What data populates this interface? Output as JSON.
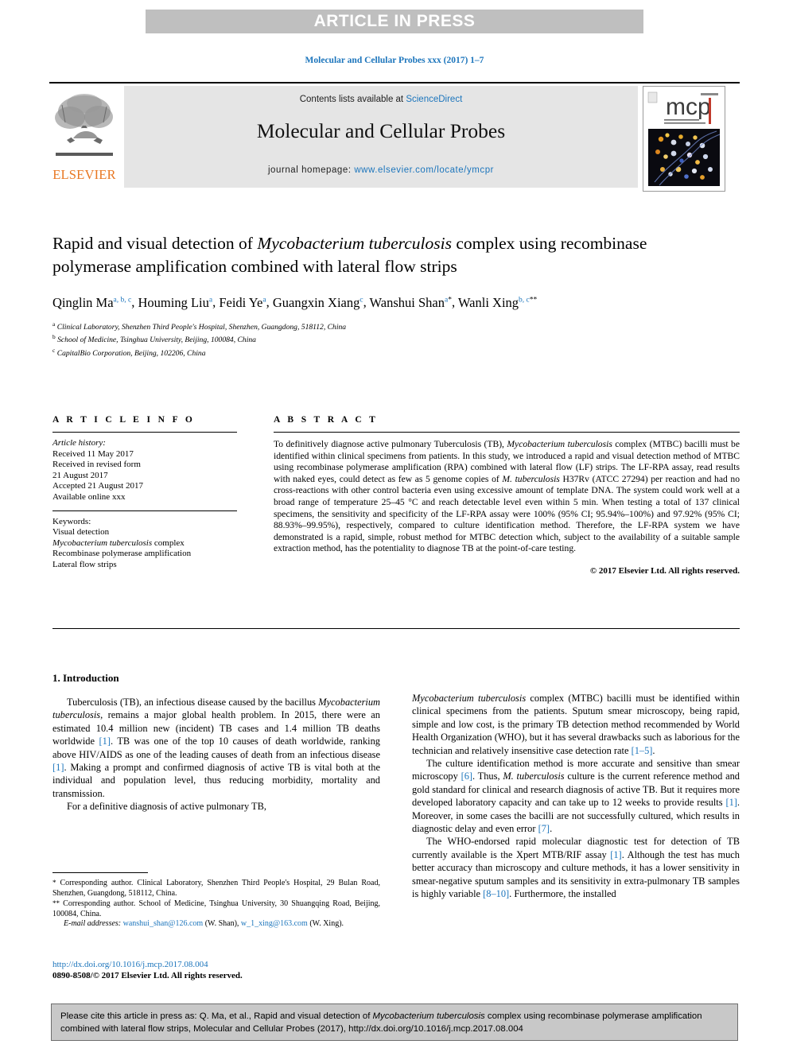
{
  "banner": {
    "label": "ARTICLE IN PRESS"
  },
  "running_head": "Molecular and Cellular Probes xxx (2017) 1–7",
  "masthead": {
    "publisher": "ELSEVIER",
    "contents_prefix": "Contents lists available at ",
    "contents_link": "ScienceDirect",
    "journal_title": "Molecular and Cellular Probes",
    "homepage_prefix": "journal homepage: ",
    "homepage_url": "www.elsevier.com/locate/ymcpr",
    "cover_mark": "mcp",
    "link_color": "#1c75bc",
    "banner_color": "#bfbfbf",
    "band_color": "#e5e5e5",
    "elsevier_orange": "#e87722"
  },
  "title": {
    "line1a": "Rapid and visual detection of ",
    "line1_italic": "Mycobacterium tuberculosis",
    "line1b": " complex",
    "line2": "using recombinase polymerase amplification combined with lateral",
    "line3": "flow strips"
  },
  "authors": [
    {
      "name": "Qinglin Ma",
      "sup": "a, b, c"
    },
    {
      "name": "Houming Liu",
      "sup": "a"
    },
    {
      "name": "Feidi Ye",
      "sup": "a"
    },
    {
      "name": "Guangxin Xiang",
      "sup": "c"
    },
    {
      "name": "Wanshui Shan",
      "sup": "a",
      "star": "*"
    },
    {
      "name": "Wanli Xing",
      "sup": "b, c",
      "star": "**"
    }
  ],
  "affiliations": [
    {
      "mark": "a",
      "text": "Clinical Laboratory, Shenzhen Third People's Hospital, Shenzhen, Guangdong, 518112, China"
    },
    {
      "mark": "b",
      "text": "School of Medicine, Tsinghua University, Beijing, 100084, China"
    },
    {
      "mark": "c",
      "text": "CapitalBio Corporation, Beijing, 102206, China"
    }
  ],
  "article_info": {
    "heading": "A R T I C L E   I N F O",
    "history_label": "Article history:",
    "history": [
      "Received 11 May 2017",
      "Received in revised form",
      "21 August 2017",
      "Accepted 21 August 2017",
      "Available online xxx"
    ],
    "keywords_label": "Keywords:",
    "keywords": [
      "Visual detection",
      "Mycobacterium tuberculosis complex",
      "Recombinase polymerase amplification",
      "Lateral flow strips"
    ]
  },
  "abstract": {
    "heading": "A B S T R A C T",
    "p1": "To definitively diagnose active pulmonary Tuberculosis (TB), ",
    "p1_italic1": "Mycobacterium tuberculosis",
    "p2": " complex (MTBC) bacilli must be identified within clinical specimens from patients. In this study, we introduced a rapid and visual detection method of MTBC using recombinase polymerase amplification (RPA) combined with lateral flow (LF) strips. The LF-RPA assay, read results with naked eyes, could detect as few as 5 genome copies of ",
    "p2_italic": "M. tuberculosis",
    "p3": " H37Rv (ATCC 27294) per reaction and had no cross-reactions with other control bacteria even using excessive amount of template DNA. The system could work well at a broad range of temperature 25–45 °C and reach detectable level even within 5 min. When testing a total of 137 clinical specimens, the sensitivity and specificity of the LF-RPA assay were 100% (95% CI; 95.94%–100%) and 97.92% (95% CI; 88.93%–99.95%), respectively, compared to culture identification method. Therefore, the LF-RPA system we have demonstrated is a rapid, simple, robust method for MTBC detection which, subject to the availability of a suitable sample extraction method, has the potentiality to diagnose TB at the point-of-care testing.",
    "copyright": "© 2017 Elsevier Ltd. All rights reserved."
  },
  "body": {
    "section_title": "1. Introduction",
    "left_p1_a": "Tuberculosis (TB), an infectious disease caused by the bacillus ",
    "left_p1_italic": "Mycobacterium tuberculosis",
    "left_p1_b": ", remains a major global health problem. In 2015, there were an estimated 10.4 million new (incident) TB cases and 1.4 million TB deaths worldwide ",
    "left_p1_ref1": "[1]",
    "left_p1_c": ". TB was one of the top 10 causes of death worldwide, ranking above HIV/AIDS as one of the leading causes of death from an infectious disease ",
    "left_p1_ref2": "[1]",
    "left_p1_d": ". Making a prompt and confirmed diagnosis of active TB is vital both at the individual and population level, thus reducing morbidity, mortality and transmission.",
    "left_p2": "For a definitive diagnosis of active pulmonary TB,",
    "right_p1_italic": "Mycobacterium tuberculosis",
    "right_p1_a": " complex (MTBC) bacilli must be identified within clinical specimens from the patients. Sputum smear microscopy, being rapid, simple and low cost, is the primary TB detection method recommended by World Health Organization (WHO), but it has several drawbacks such as laborious for the technician and relatively insensitive case detection rate ",
    "right_p1_ref": "[1–5]",
    "right_p1_b": ".",
    "right_p2_a": "The culture identification method is more accurate and sensitive than smear microscopy ",
    "right_p2_ref1": "[6]",
    "right_p2_b": ". Thus, ",
    "right_p2_italic": "M. tuberculosis",
    "right_p2_c": " culture is the current reference method and gold standard for clinical and research diagnosis of active TB. But it requires more developed laboratory capacity and can take up to 12 weeks to provide results ",
    "right_p2_ref2": "[1]",
    "right_p2_d": ". Moreover, in some cases the bacilli are not successfully cultured, which results in diagnostic delay and even error ",
    "right_p2_ref3": "[7]",
    "right_p2_e": ".",
    "right_p3_a": "The WHO-endorsed rapid molecular diagnostic test for detection of TB currently available is the Xpert MTB/RIF assay ",
    "right_p3_ref1": "[1]",
    "right_p3_b": ". Although the test has much better accuracy than microscopy and culture methods, it has a lower sensitivity in smear-negative sputum samples and its sensitivity in extra-pulmonary TB samples is highly variable ",
    "right_p3_ref2": "[8–10]",
    "right_p3_c": ". Furthermore, the installed"
  },
  "footnotes": {
    "fn1_mark": "*",
    "fn1": " Corresponding author. Clinical Laboratory, Shenzhen Third People's Hospital, 29 Bulan Road, Shenzhen, Guangdong, 518112, China.",
    "fn2_mark": "**",
    "fn2": " Corresponding author. School of Medicine, Tsinghua University, 30 Shuangqing Road, Beijing, 100084, China.",
    "email_label": "E-mail addresses:",
    "email1": "wanshui_shan@126.com",
    "email1_who": " (W. Shan), ",
    "email2": "w_1_xing@163.com",
    "email2_who": " (W. Xing)."
  },
  "doi": {
    "url": "http://dx.doi.org/10.1016/j.mcp.2017.08.004",
    "issn": "0890-8508/© 2017 Elsevier Ltd. All rights reserved."
  },
  "citation_footer": {
    "a": "Please cite this article in press as: Q. Ma, et al., Rapid and visual detection of ",
    "italic": "Mycobacterium tuberculosis",
    "b": " complex using recombinase polymerase amplification combined with lateral flow strips, Molecular and Cellular Probes (2017), http://dx.doi.org/10.1016/j.mcp.2017.08.004"
  }
}
